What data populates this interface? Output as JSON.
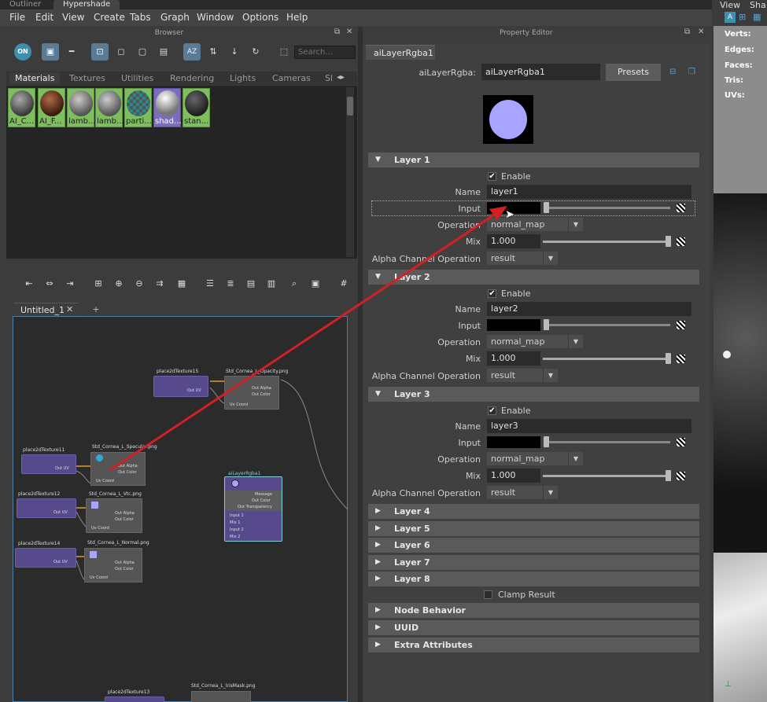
{
  "window_tabs": [
    "Outliner",
    "Hypershade"
  ],
  "menu": [
    "File",
    "Edit",
    "View",
    "Create",
    "Tabs",
    "Graph",
    "Window",
    "Options",
    "Help"
  ],
  "browser": {
    "title": "Browser",
    "search_placeholder": "Search...",
    "toggle_label": "ON",
    "tabs": [
      "Materials",
      "Textures",
      "Utilities",
      "Rendering",
      "Lights",
      "Cameras",
      "Sl"
    ],
    "materials": [
      {
        "label": "AI_C...",
        "color": "#6a6a6a"
      },
      {
        "label": "AI_F...",
        "color": "#6b3a22"
      },
      {
        "label": "lamb...",
        "color": "#8a8a8a"
      },
      {
        "label": "lamb...",
        "color": "#8a8a8a"
      },
      {
        "label": "parti...",
        "color": "checker"
      },
      {
        "label": "shad...",
        "color": "#c9c9c9"
      },
      {
        "label": "stan...",
        "color": "#4a4a4a"
      }
    ]
  },
  "graph": {
    "tabs": [
      "Untitled_1",
      "+"
    ],
    "nodes": [
      {
        "title": "place2dTexture15",
        "ports": [
          "Out UV"
        ]
      },
      {
        "title": "Std_Cornea_L_Opacity.png",
        "ports": [
          "Out Alpha",
          "Out Color",
          "Uv Coord"
        ]
      },
      {
        "title": "place2dTexture11",
        "ports": [
          "Out UV"
        ]
      },
      {
        "title": "Std_Cornea_L_Specular.png",
        "ports": [
          "Out Alpha",
          "Out Color",
          "Uv Coord"
        ]
      },
      {
        "title": "place2dTexture12",
        "ports": [
          "Out UV"
        ]
      },
      {
        "title": "Std_Cornea_L_Vtc.png",
        "ports": [
          "Out Alpha",
          "Out Color",
          "Uv Coord"
        ]
      },
      {
        "title": "place2dTexture14",
        "ports": [
          "Out UV"
        ]
      },
      {
        "title": "Std_Cornea_L_Normal.png",
        "ports": [
          "Out Alpha",
          "Out Color",
          "Uv Coord"
        ]
      },
      {
        "title": "aiLayerRgba1",
        "ports": [
          "Message",
          "Out Color",
          "Out Transparency",
          "Input 1",
          "Mix 1",
          "Input 2",
          "Mix 2"
        ]
      },
      {
        "title": "place2dTexture13",
        "ports": []
      },
      {
        "title": "Std_Cornea_L_IrisMask.png",
        "ports": []
      }
    ]
  },
  "property_editor": {
    "title": "Property Editor",
    "tab": "aiLayerRgba1",
    "node_type_label": "aiLayerRgba:",
    "node_name": "aiLayerRgba1",
    "presets": "Presets",
    "layers": [
      {
        "title": "Layer 1",
        "enable": "Enable",
        "name_label": "Name",
        "name": "layer1",
        "input_label": "Input",
        "operation_label": "Operation",
        "operation": "normal_map",
        "mix_label": "Mix",
        "mix": "1.000",
        "alpha_label": "Alpha Channel Operation",
        "alpha": "result"
      },
      {
        "title": "Layer 2",
        "enable": "Enable",
        "name_label": "Name",
        "name": "layer2",
        "input_label": "Input",
        "operation_label": "Operation",
        "operation": "normal_map",
        "mix_label": "Mix",
        "mix": "1.000",
        "alpha_label": "Alpha Channel Operation",
        "alpha": "result"
      },
      {
        "title": "Layer 3",
        "enable": "Enable",
        "name_label": "Name",
        "name": "layer3",
        "input_label": "Input",
        "operation_label": "Operation",
        "operation": "normal_map",
        "mix_label": "Mix",
        "mix": "1.000",
        "alpha_label": "Alpha Channel Operation",
        "alpha": "result"
      }
    ],
    "collapsed": [
      "Layer 4",
      "Layer 5",
      "Layer 6",
      "Layer 7",
      "Layer 8"
    ],
    "clamp": "Clamp Result",
    "extra": [
      "Node Behavior",
      "UUID",
      "Extra Attributes"
    ]
  },
  "viewport": {
    "tabs": [
      "View",
      "Sha"
    ],
    "stats": [
      "Verts:",
      "Edges:",
      "Faces:",
      "Tris:",
      "UVs:"
    ]
  }
}
